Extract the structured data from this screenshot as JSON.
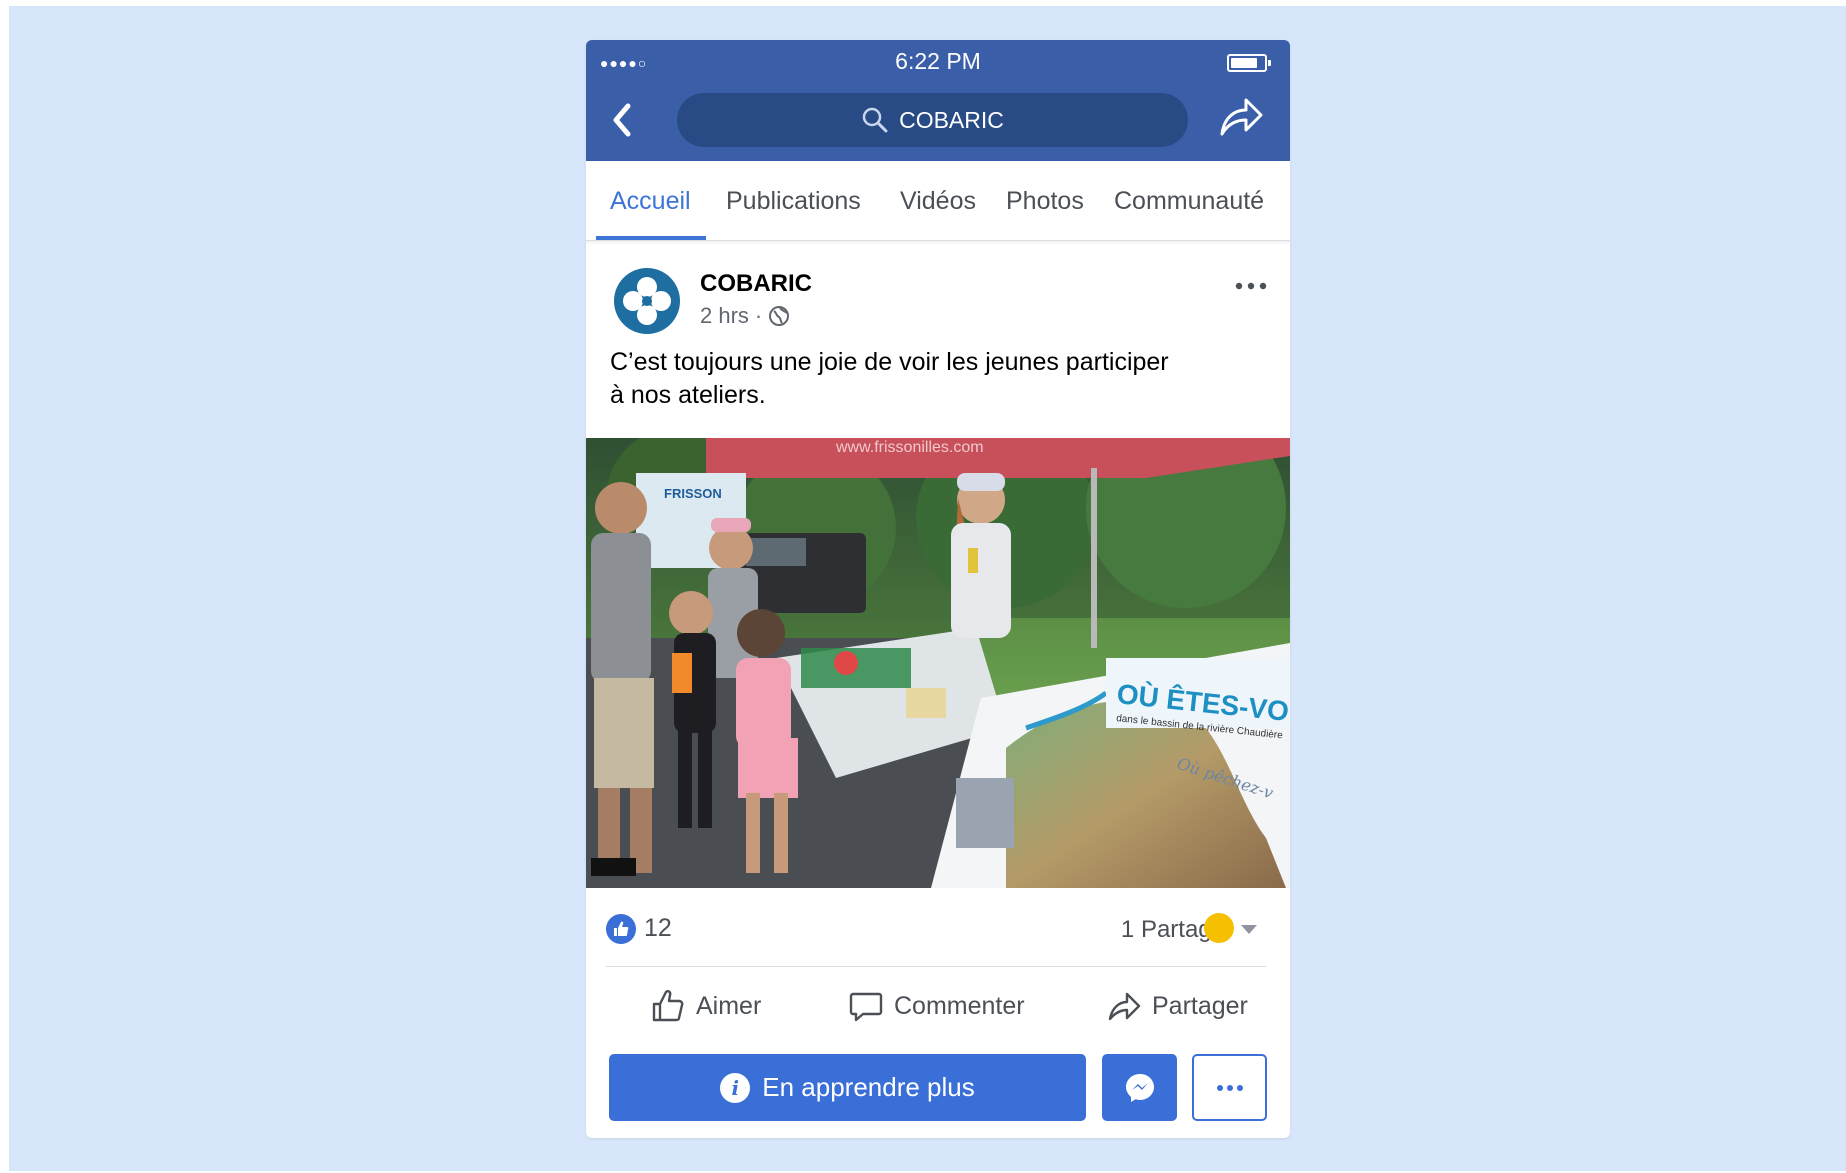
{
  "status_bar": {
    "signal": "●●●●○",
    "time": "6:22 PM"
  },
  "header": {
    "search_text": "COBARIC"
  },
  "tabs": [
    {
      "label": "Accueil",
      "active": true
    },
    {
      "label": "Publications",
      "active": false
    },
    {
      "label": "Vidéos",
      "active": false
    },
    {
      "label": "Photos",
      "active": false
    },
    {
      "label": "Communauté",
      "active": false
    }
  ],
  "post": {
    "page_name": "COBARIC",
    "time": "2 hrs",
    "separator": "·",
    "text_line1": "C’est toujours une joie de voir les jeunes participer",
    "text_line2": "à nos ateliers.",
    "photo": {
      "sign_title": "OÙ ÊTES-VOUS?",
      "sign_subtitle": "dans le bassin de la rivière Chaudière",
      "handwriting": "Où pêchez-v",
      "truck_sign": "FRISSON",
      "tent_text": "www.frissonilles.com"
    }
  },
  "reactions": {
    "like_count": "12",
    "shares": "1 Partage"
  },
  "actions": {
    "like": "Aimer",
    "comment": "Commenter",
    "share": "Partager"
  },
  "cta": {
    "label": "En apprendre plus",
    "info_icon": "i"
  },
  "colors": {
    "header_bg": "#3b5ea9",
    "search_bg": "#284a85",
    "accent": "#3a6fd8",
    "backdrop": "#d8e6fb"
  }
}
